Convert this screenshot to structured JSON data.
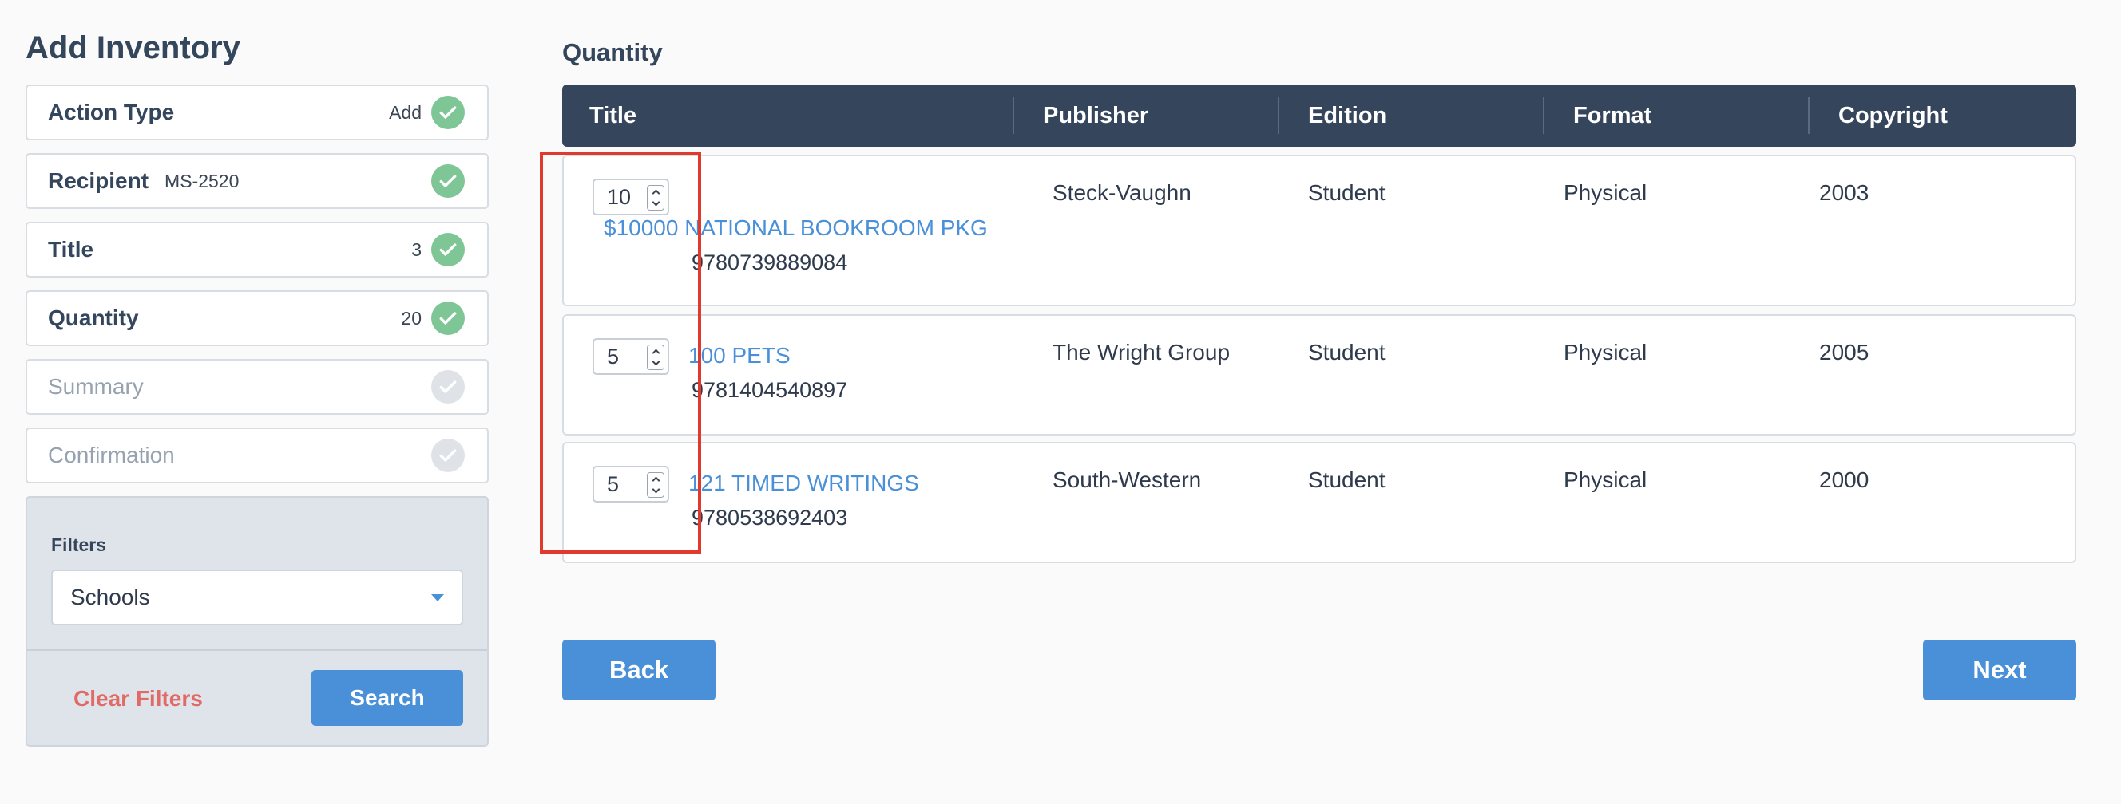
{
  "page_title": "Add Inventory",
  "steps": [
    {
      "label": "Action Type",
      "sub": "",
      "value": "Add",
      "status": "complete"
    },
    {
      "label": "Recipient",
      "sub": "MS-2520",
      "value": "",
      "status": "complete"
    },
    {
      "label": "Title",
      "sub": "",
      "value": "3",
      "status": "complete"
    },
    {
      "label": "Quantity",
      "sub": "",
      "value": "20",
      "status": "complete"
    },
    {
      "label": "Summary",
      "sub": "",
      "value": "",
      "status": "pending"
    },
    {
      "label": "Confirmation",
      "sub": "",
      "value": "",
      "status": "pending"
    }
  ],
  "filters": {
    "label": "Filters",
    "selected": "Schools",
    "clear_label": "Clear Filters",
    "search_label": "Search"
  },
  "main": {
    "section_title": "Quantity",
    "columns": [
      "Title",
      "Publisher",
      "Edition",
      "Format",
      "Copyright"
    ],
    "rows": [
      {
        "qty": "10",
        "title": "$10000 NATIONAL BOOKROOM PKG",
        "isbn": "9780739889084",
        "publisher": "Steck-Vaughn",
        "edition": "Student",
        "format": "Physical",
        "copyright": "2003"
      },
      {
        "qty": "5",
        "title": "100 PETS",
        "isbn": "9781404540897",
        "publisher": "The Wright Group",
        "edition": "Student",
        "format": "Physical",
        "copyright": "2005"
      },
      {
        "qty": "5",
        "title": "121 TIMED WRITINGS",
        "isbn": "9780538692403",
        "publisher": "South-Western",
        "edition": "Student",
        "format": "Physical",
        "copyright": "2000"
      }
    ],
    "back_label": "Back",
    "next_label": "Next"
  },
  "colors": {
    "accent": "#4a90d9",
    "header_bg": "#35465c",
    "check_green": "#7ec695",
    "danger": "#e06a66",
    "highlight": "#e03a2f"
  }
}
